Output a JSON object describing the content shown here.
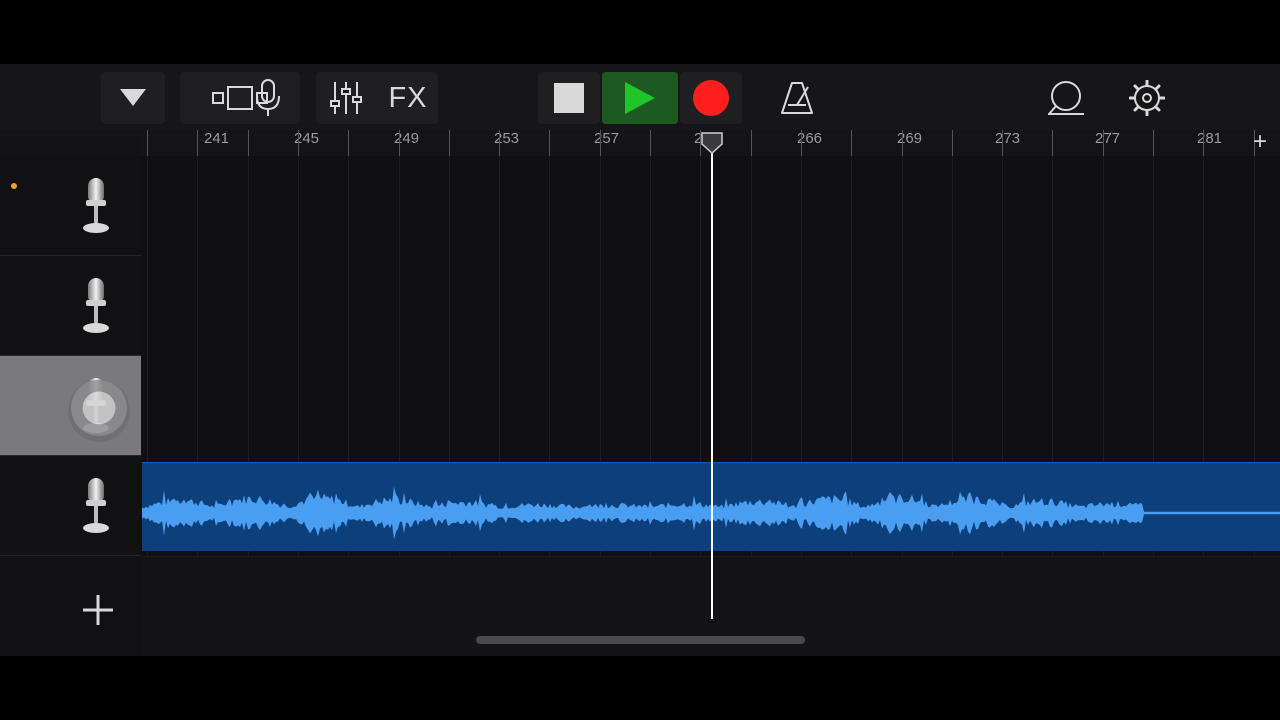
{
  "toolbar": {
    "buttons": [
      {
        "name": "browser-menu-button",
        "icon": "triangle-down-icon"
      },
      {
        "name": "track-view-button",
        "icon": "track-view-icon"
      },
      {
        "name": "instrument-button",
        "icon": "microphone-icon"
      },
      {
        "name": "mixer-button",
        "icon": "sliders-icon"
      },
      {
        "name": "fx-button",
        "label": "FX"
      },
      {
        "name": "stop-button",
        "icon": "stop-icon"
      },
      {
        "name": "play-button",
        "icon": "play-icon",
        "active": true
      },
      {
        "name": "record-button",
        "icon": "record-icon"
      },
      {
        "name": "metronome-button",
        "icon": "metronome-icon"
      },
      {
        "name": "loop-browser-button",
        "icon": "loop-icon"
      },
      {
        "name": "settings-button",
        "icon": "gear-icon"
      }
    ],
    "fx_label": "FX"
  },
  "ruler": {
    "bars": [
      "241",
      "245",
      "249",
      "253",
      "257",
      "261",
      "266",
      "269",
      "273",
      "277",
      "281"
    ],
    "add_section_label": "+"
  },
  "tracks": [
    {
      "name": "audio-recorder-1",
      "icon": "microphone-icon",
      "record_armed": true,
      "selected": false
    },
    {
      "name": "audio-recorder-2",
      "icon": "microphone-icon",
      "record_armed": false,
      "selected": false
    },
    {
      "name": "audio-recorder-3",
      "icon": "microphone-icon",
      "record_armed": false,
      "selected": true
    },
    {
      "name": "audio-recorder-4",
      "icon": "microphone-icon",
      "record_armed": false,
      "selected": false
    }
  ],
  "add_track_label": "+",
  "colors": {
    "play_green": "#1fc52a",
    "play_bg": "#1c5a22",
    "record_red": "#ff1e1e",
    "region_blue": "#0d3f7a",
    "waveform_blue": "#4a9ef2",
    "record_arm_orange": "#f0a030"
  }
}
